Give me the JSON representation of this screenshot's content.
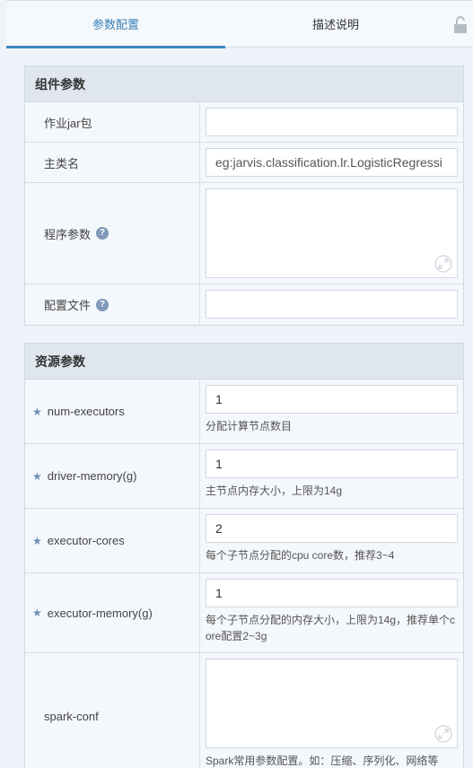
{
  "tabs": [
    {
      "label": "参数配置"
    },
    {
      "label": "描述说明"
    }
  ],
  "colors": {
    "accent": "#3b88c3",
    "star": "#6f8fb4",
    "help_icon": "#7f98b7"
  },
  "component_section": {
    "title": "组件参数",
    "rows": [
      {
        "label": "作业jar包",
        "value": ""
      },
      {
        "label": "主类名",
        "placeholder": "eg:jarvis.classification.lr.LogisticRegressi"
      },
      {
        "label": "程序参数",
        "value": ""
      },
      {
        "label": "配置文件",
        "value": ""
      }
    ]
  },
  "resource_section": {
    "title": "资源参数",
    "rows": [
      {
        "label": "num-executors",
        "value": "1",
        "hint": "分配计算节点数目"
      },
      {
        "label": "driver-memory(g)",
        "value": "1",
        "hint": "主节点内存大小，上限为14g"
      },
      {
        "label": "executor-cores",
        "value": "2",
        "hint": "每个子节点分配的cpu core数，推荐3~4"
      },
      {
        "label": "executor-memory(g)",
        "value": "1",
        "hint_line1": "每个子节点分配的内存大小，上限为14g，推荐单个c",
        "hint_line2": "ore配置2~3g"
      },
      {
        "label": "spark-conf",
        "value": "",
        "hint": "Spark常用参数配置。如：压缩、序列化、网络等"
      }
    ]
  }
}
